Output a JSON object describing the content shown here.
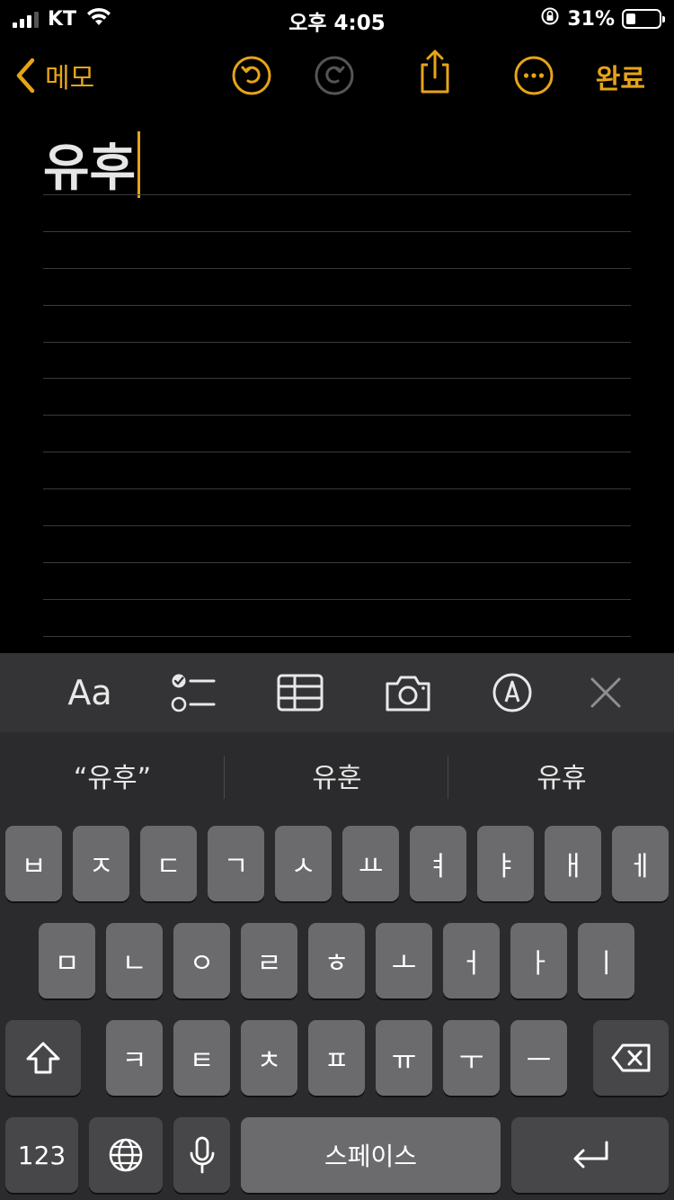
{
  "status_bar": {
    "carrier": "KT",
    "time": "오후 4:05",
    "battery_percent": "31%"
  },
  "nav": {
    "back_label": "메모",
    "done_label": "완료"
  },
  "note": {
    "title": "유후"
  },
  "toolbar": {
    "format_label": "Aa"
  },
  "suggestions": [
    "“유후”",
    "유훈",
    "유휴"
  ],
  "keyboard": {
    "row1": [
      "ㅂ",
      "ㅈ",
      "ㄷ",
      "ㄱ",
      "ㅅ",
      "ㅛ",
      "ㅕ",
      "ㅑ",
      "ㅐ",
      "ㅔ"
    ],
    "row2": [
      "ㅁ",
      "ㄴ",
      "ㅇ",
      "ㄹ",
      "ㅎ",
      "ㅗ",
      "ㅓ",
      "ㅏ",
      "ㅣ"
    ],
    "row3": [
      "ㅋ",
      "ㅌ",
      "ㅊ",
      "ㅍ",
      "ㅠ",
      "ㅜ",
      "ㅡ"
    ],
    "numbers_label": "123",
    "space_label": "스페이스"
  },
  "colors": {
    "accent": "#e6a418",
    "background": "#000000",
    "toolbar": "#343436",
    "keyboard": "#2b2b2d",
    "key": "#6b6b6d",
    "key_dark": "#474749"
  }
}
